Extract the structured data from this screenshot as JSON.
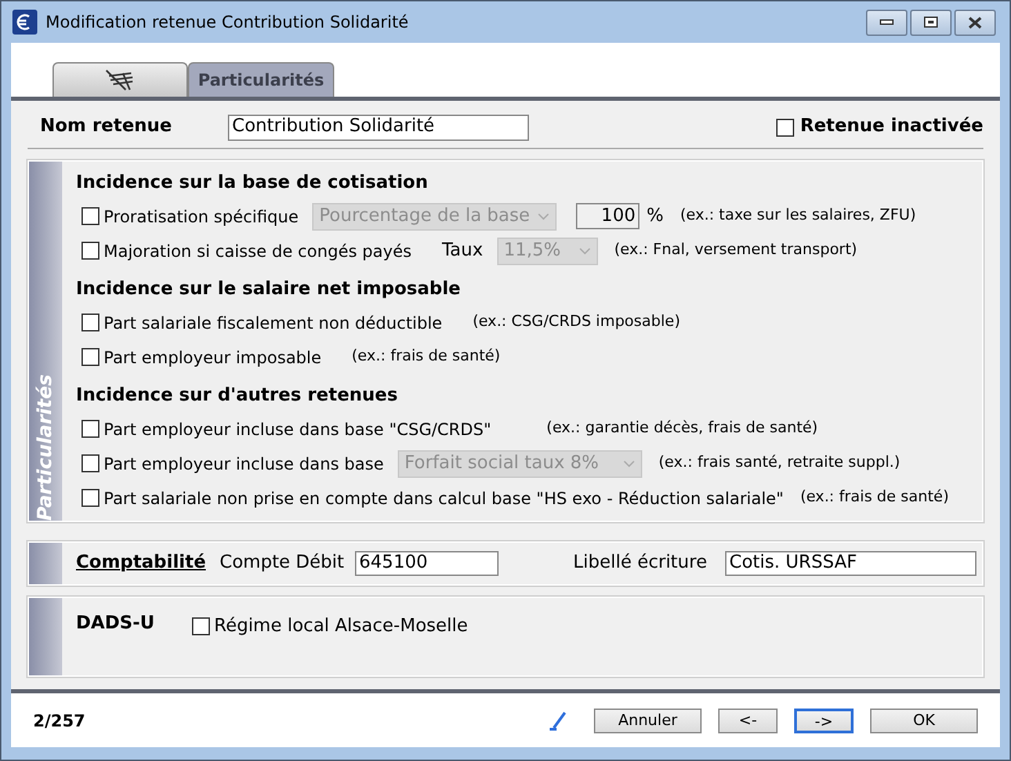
{
  "window": {
    "title": "Modification retenue Contribution Solidarité"
  },
  "tabs": [
    {
      "kind": "icon",
      "selected": false
    },
    {
      "kind": "text",
      "label": "Particularités",
      "selected": true
    }
  ],
  "name_field": {
    "label": "Nom retenue",
    "value": "Contribution Solidarité"
  },
  "inactive": {
    "label": "Retenue inactivée",
    "checked": false
  },
  "particularites": {
    "side_label": "Particularités",
    "groups": [
      {
        "title": "Incidence sur la base de cotisation",
        "options": [
          {
            "label": "Proratisation spécifique",
            "checked": false,
            "select": {
              "value": "Pourcentage de la base",
              "disabled": true
            },
            "percent": {
              "value": "100",
              "unit": "%"
            },
            "example": "(ex.: taxe sur les salaires, ZFU)"
          },
          {
            "label": "Majoration si caisse de congés payés",
            "checked": false,
            "rate_label": "Taux",
            "select": {
              "value": "11,5%",
              "disabled": true
            },
            "example": "(ex.: Fnal, versement transport)"
          }
        ]
      },
      {
        "title": "Incidence sur le salaire net imposable",
        "options": [
          {
            "label": "Part salariale fiscalement non déductible",
            "checked": false,
            "example": "(ex.: CSG/CRDS imposable)"
          },
          {
            "label": "Part employeur imposable",
            "checked": false,
            "example": "(ex.: frais de santé)"
          }
        ]
      },
      {
        "title": "Incidence sur d'autres retenues",
        "options": [
          {
            "label": "Part employeur incluse dans base \"CSG/CRDS\"",
            "checked": false,
            "example": "(ex.: garantie décès, frais de santé)"
          },
          {
            "label": "Part employeur incluse dans base",
            "checked": false,
            "select": {
              "value": "Forfait social taux 8%",
              "disabled": true
            },
            "example": "(ex.: frais santé, retraite suppl.)"
          },
          {
            "label": "Part salariale non prise en compte dans calcul base \"HS exo - Réduction salariale\"",
            "checked": false,
            "example": "(ex.: frais de santé)"
          }
        ]
      }
    ]
  },
  "comptabilite": {
    "title": "Comptabilité",
    "debit_label": "Compte Débit",
    "debit_value": "645100",
    "libelle_label": "Libellé écriture",
    "libelle_value": "Cotis. URSSAF"
  },
  "dads": {
    "title": "DADS-U",
    "option": {
      "label": "Régime local Alsace-Moselle",
      "checked": false
    }
  },
  "footer": {
    "record": "2/257",
    "buttons": [
      {
        "label": "Annuler",
        "focused": false
      },
      {
        "label": "<-",
        "focused": false
      },
      {
        "label": "->",
        "focused": true
      },
      {
        "label": "OK",
        "focused": false
      }
    ]
  }
}
